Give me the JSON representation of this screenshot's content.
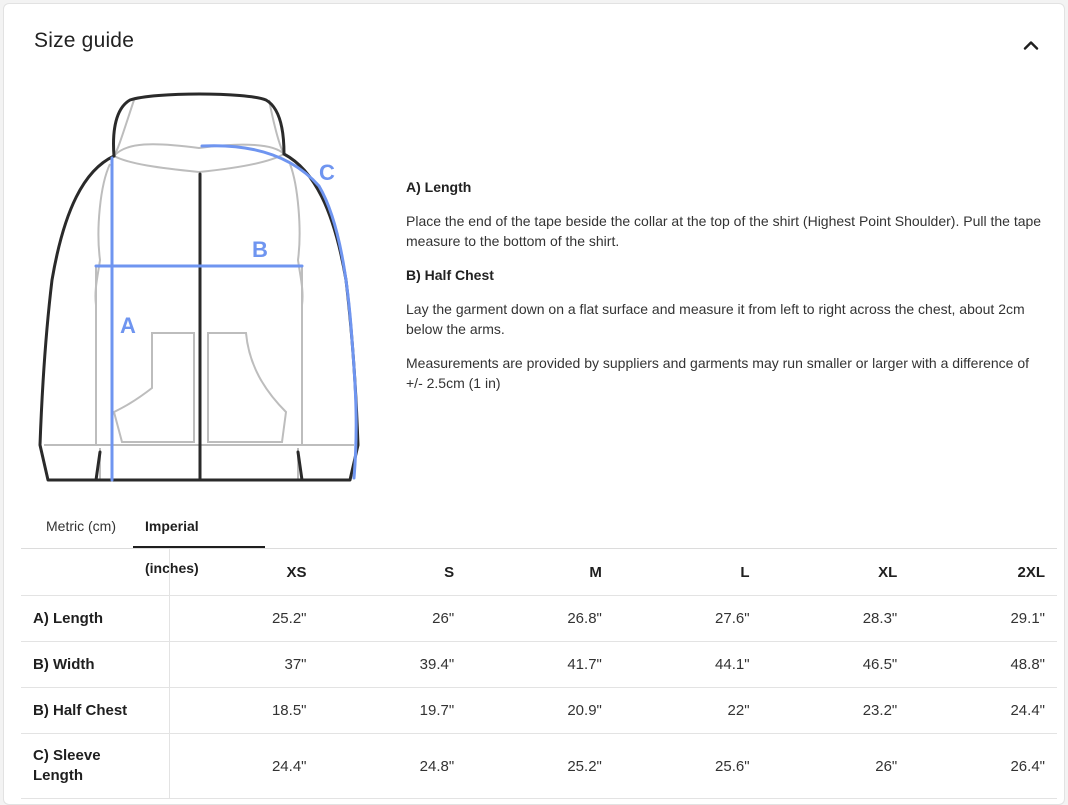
{
  "header": {
    "title": "Size guide",
    "collapse_icon": "chevron-up-icon"
  },
  "diagram": {
    "garment": "zip-hoodie",
    "labels": {
      "length": "A",
      "half_chest": "B",
      "sleeve": "C"
    },
    "accent_color": "#6f95f0",
    "outline_color": "#2a2a2a",
    "detail_color": "#bdbdbd"
  },
  "instructions": {
    "length_heading": "A) Length",
    "length_text": "Place the end of the tape beside the collar at the top of the shirt (Highest Point Shoulder). Pull the tape measure to the bottom of the shirt.",
    "chest_heading": "B) Half Chest",
    "chest_text": "Lay the garment down on a flat surface and measure it from left to right across the chest, about 2cm below the arms.",
    "note": "Measurements are provided by suppliers and garments may run smaller or larger with a difference of +/- 2.5cm (1 in)"
  },
  "tabs": [
    {
      "label": "Metric (cm)",
      "active": false
    },
    {
      "label": "Imperial (inches)",
      "active": true
    }
  ],
  "table": {
    "columns": [
      "XS",
      "S",
      "M",
      "L",
      "XL",
      "2XL"
    ],
    "rows": [
      {
        "label": "A) Length",
        "values": [
          "25.2\"",
          "26\"",
          "26.8\"",
          "27.6\"",
          "28.3\"",
          "29.1\""
        ]
      },
      {
        "label": "B) Width",
        "values": [
          "37\"",
          "39.4\"",
          "41.7\"",
          "44.1\"",
          "46.5\"",
          "48.8\""
        ]
      },
      {
        "label": "B) Half Chest",
        "values": [
          "18.5\"",
          "19.7\"",
          "20.9\"",
          "22\"",
          "23.2\"",
          "24.4\""
        ]
      },
      {
        "label": "C) Sleeve Length",
        "values": [
          "24.4\"",
          "24.8\"",
          "25.2\"",
          "25.6\"",
          "26\"",
          "26.4\""
        ]
      }
    ]
  }
}
